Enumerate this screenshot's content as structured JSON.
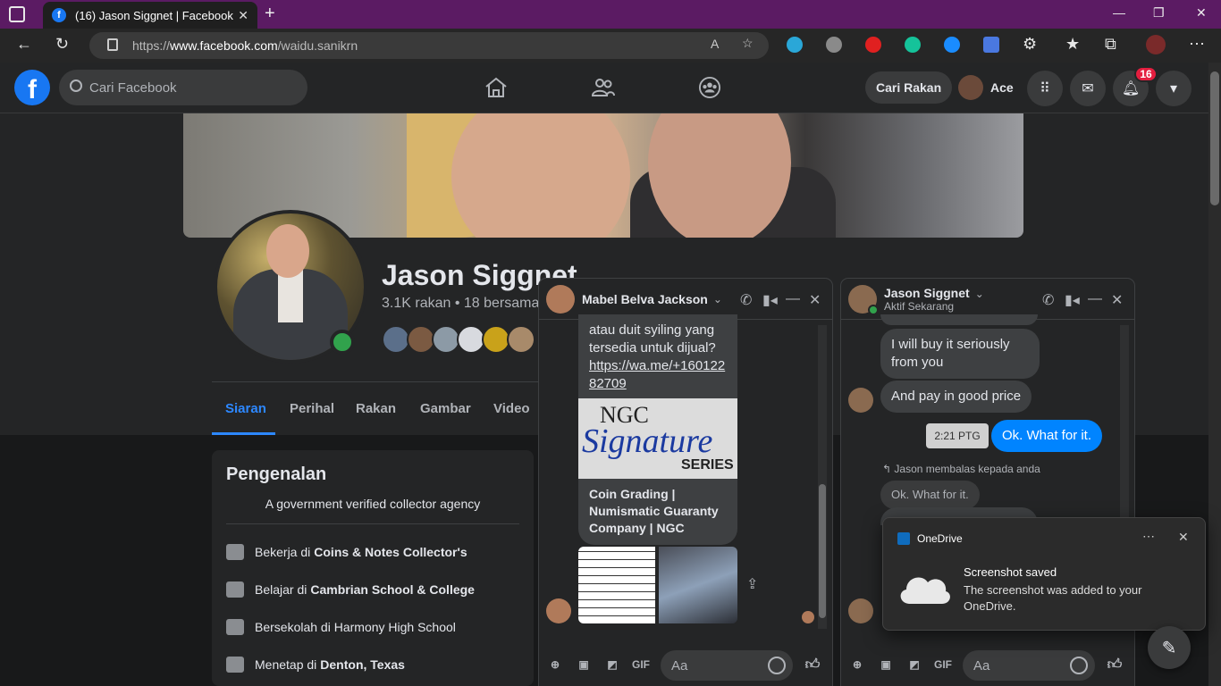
{
  "browser": {
    "tab_title": "(16) Jason Siggnet | Facebook",
    "url_prefix": "https://",
    "url_host": "www.facebook.com",
    "url_path": "/waidu.sanikrn"
  },
  "header": {
    "search_placeholder": "Cari Facebook",
    "find_friends": "Cari Rakan",
    "me_name": "Ace",
    "notif_count": "16"
  },
  "profile": {
    "name": "Jason Siggnet",
    "friends": "3.1K rakan • 18 bersama",
    "tabs": [
      "Siaran",
      "Perihal",
      "Rakan",
      "Gambar",
      "Video"
    ]
  },
  "intro": {
    "title": "Pengenalan",
    "bio": "A government verified collector agency",
    "rows": [
      {
        "prefix": "Bekerja di",
        "bold": "Coins & Notes Collector's"
      },
      {
        "prefix": "Belajar di",
        "bold": "Cambrian School & College"
      },
      {
        "prefix": "Bersekolah di Harmony High School",
        "bold": ""
      },
      {
        "prefix": "Menetap di",
        "bold": "Denton, Texas"
      }
    ]
  },
  "chat1": {
    "name": "Mabel Belva Jackson",
    "msg_text": "atau duit syiling yang tersedia untuk dijual?",
    "msg_link": "https://wa.me/+16012282709",
    "link_preview_title": "Coin Grading | Numismatic Guaranty Company | NGC",
    "ngc_logo": "NGC",
    "ngc_script": "Signature",
    "ngc_series": "SERIES",
    "composer_placeholder": "Aa",
    "gif": "GIF"
  },
  "chat2": {
    "name": "Jason Siggnet",
    "status": "Aktif Sekarang",
    "messages": [
      {
        "text": "I will buy it seriously from you"
      },
      {
        "text": "And pay in good price"
      }
    ],
    "time_chip": "2:21 PTG",
    "outgoing": "Ok. What for it.",
    "reply_label": "Jason membalas kepada anda",
    "quoted": "Ok. What for it.",
    "composer_placeholder": "Aa",
    "gif": "GIF"
  },
  "toast": {
    "app": "OneDrive",
    "title": "Screenshot saved",
    "body": "The screenshot was added to your OneDrive."
  },
  "colors": {
    "fb_blue": "#1877f2",
    "messenger_blue": "#0084ff",
    "tab_purple": "#5b1b63"
  }
}
